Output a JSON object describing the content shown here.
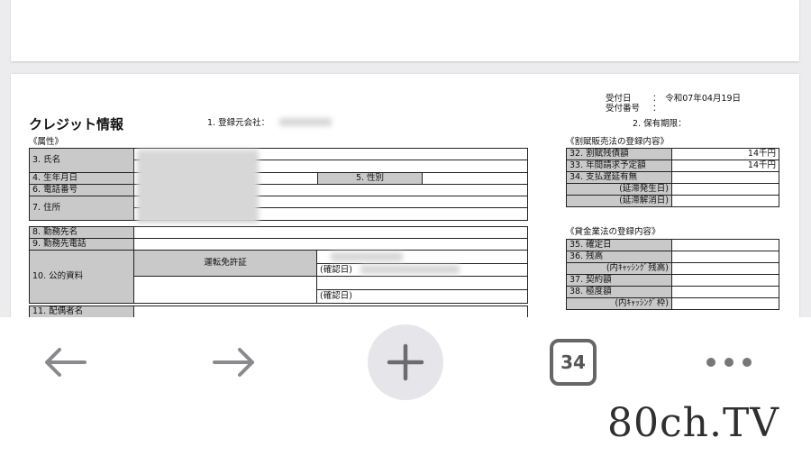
{
  "document": {
    "title": "クレジット情報",
    "registrant_label": "1. 登録元会社：",
    "received_date_label": "受付日",
    "received_date_value": "：　令和07年04月19日",
    "received_no_label": "受付番号",
    "received_no_value": "：",
    "retention_label": "2. 保有期限：",
    "attributes_header": "《属性》",
    "fields": {
      "name": "3. 氏名",
      "birthdate": "4. 生年月日",
      "gender": "5. 性別",
      "phone": "6. 電話番号",
      "address": "7. 住所",
      "employer": "8. 勤務先名",
      "employer_phone": "9. 勤務先電話",
      "public_doc": "10. 公的資料",
      "license": "運転免許証",
      "confirm_date_1": "(確認日)",
      "confirm_date_2": "(確認日)",
      "spouse": "11. 配偶者名"
    },
    "installment": {
      "header": "《割賦販売法の登録内容》",
      "debt_label": "32. 割賦残債額",
      "debt_value": "14千円",
      "annual_label": "33. 年間請求予定額",
      "annual_value": "14千円",
      "delay_label": "34. 支払遅延有無",
      "delay_start": "(延滞発生日)",
      "delay_end": "(延滞解消日)"
    },
    "money_lending": {
      "header": "《貸金業法の登録内容》",
      "confirm_label": "35. 確定日",
      "balance_label": "36. 残高",
      "balance_cashing": "(内ｷｬｯｼﾝｸﾞ残高)",
      "contract_label": "37. 契約額",
      "limit_label": "38. 極度額",
      "limit_cashing": "(内ｷｬｯｼﾝｸﾞ枠)"
    }
  },
  "toolbar": {
    "back_icon": "back-arrow-icon",
    "forward_icon": "forward-arrow-icon",
    "new_tab_icon": "plus-icon",
    "tab_count": "34",
    "more_icon": "more-dots-icon"
  },
  "watermark": "80ch.TV",
  "colors": {
    "cell_gray": "#c9c9c9",
    "toolbar_icon": "#8a8a8e",
    "plus_bg": "#e6e6ea"
  }
}
